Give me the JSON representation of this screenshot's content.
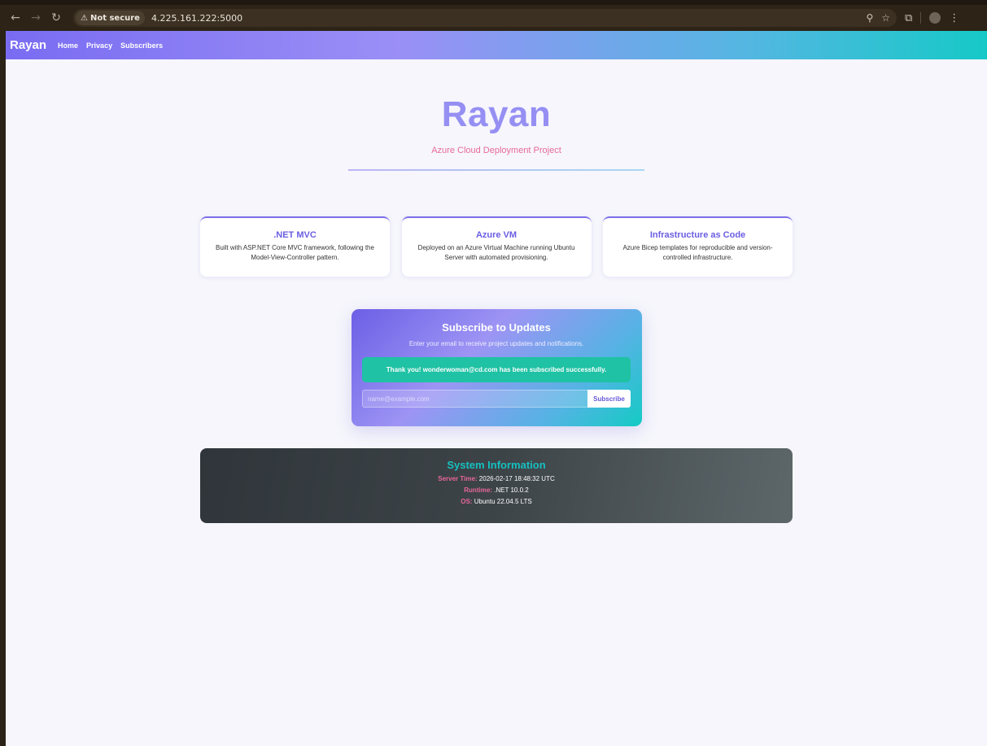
{
  "browser": {
    "security_label": "Not secure",
    "url": "4.225.161.222:5000"
  },
  "nav": {
    "brand": "Rayan",
    "links": [
      "Home",
      "Privacy",
      "Subscribers"
    ]
  },
  "hero": {
    "title": "Rayan",
    "subtitle": "Azure Cloud Deployment Project"
  },
  "features": [
    {
      "title": ".NET MVC",
      "description": "Built with ASP.NET Core MVC framework, following the Model-View-Controller pattern."
    },
    {
      "title": "Azure VM",
      "description": "Deployed on an Azure Virtual Machine running Ubuntu Server with automated provisioning."
    },
    {
      "title": "Infrastructure as Code",
      "description": "Azure Bicep templates for reproducible and version-controlled infrastructure."
    }
  ],
  "subscribe": {
    "title": "Subscribe to Updates",
    "description": "Enter your email to receive project updates and notifications.",
    "success_message": "Thank you! wonderwoman@cd.com has been subscribed successfully.",
    "email_placeholder": "name@example.com",
    "button_label": "Subscribe"
  },
  "system_info": {
    "title": "System Information",
    "server_time_label": "Server Time:",
    "server_time": "2026-02-17 18:48:32 UTC",
    "runtime_label": "Runtime:",
    "runtime": ".NET 10.0.2",
    "os_label": "OS:",
    "os": "Ubuntu 22.04.5 LTS"
  },
  "colors": {
    "accent": "#6a5de2",
    "hero_title": "#968ff3",
    "pink": "#e8699b",
    "teal": "#16c0c0",
    "success": "#1fc2a4"
  }
}
